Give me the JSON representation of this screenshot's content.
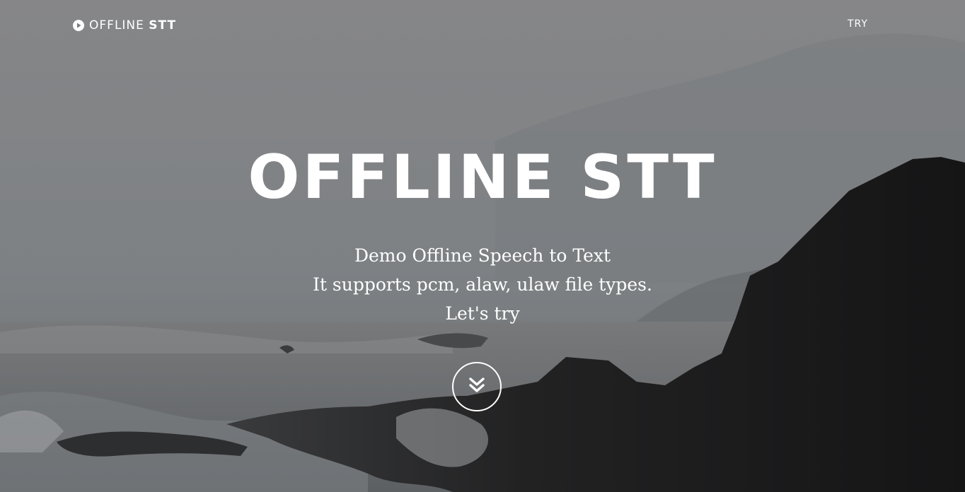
{
  "nav": {
    "brand_light": "OFFLINE",
    "brand_bold": "STT",
    "brand_icon": "play-circle-icon",
    "try_label": "TRY"
  },
  "hero": {
    "title": "OFFLINE STT",
    "lines": [
      "Demo Offline Speech to Text",
      "It supports pcm, alaw, ulaw file types.",
      "Let's try"
    ],
    "scroll_icon": "double-chevron-down-icon"
  },
  "colors": {
    "text": "#ffffff",
    "sky": "#838486",
    "cliff": "#1a1a1b"
  }
}
